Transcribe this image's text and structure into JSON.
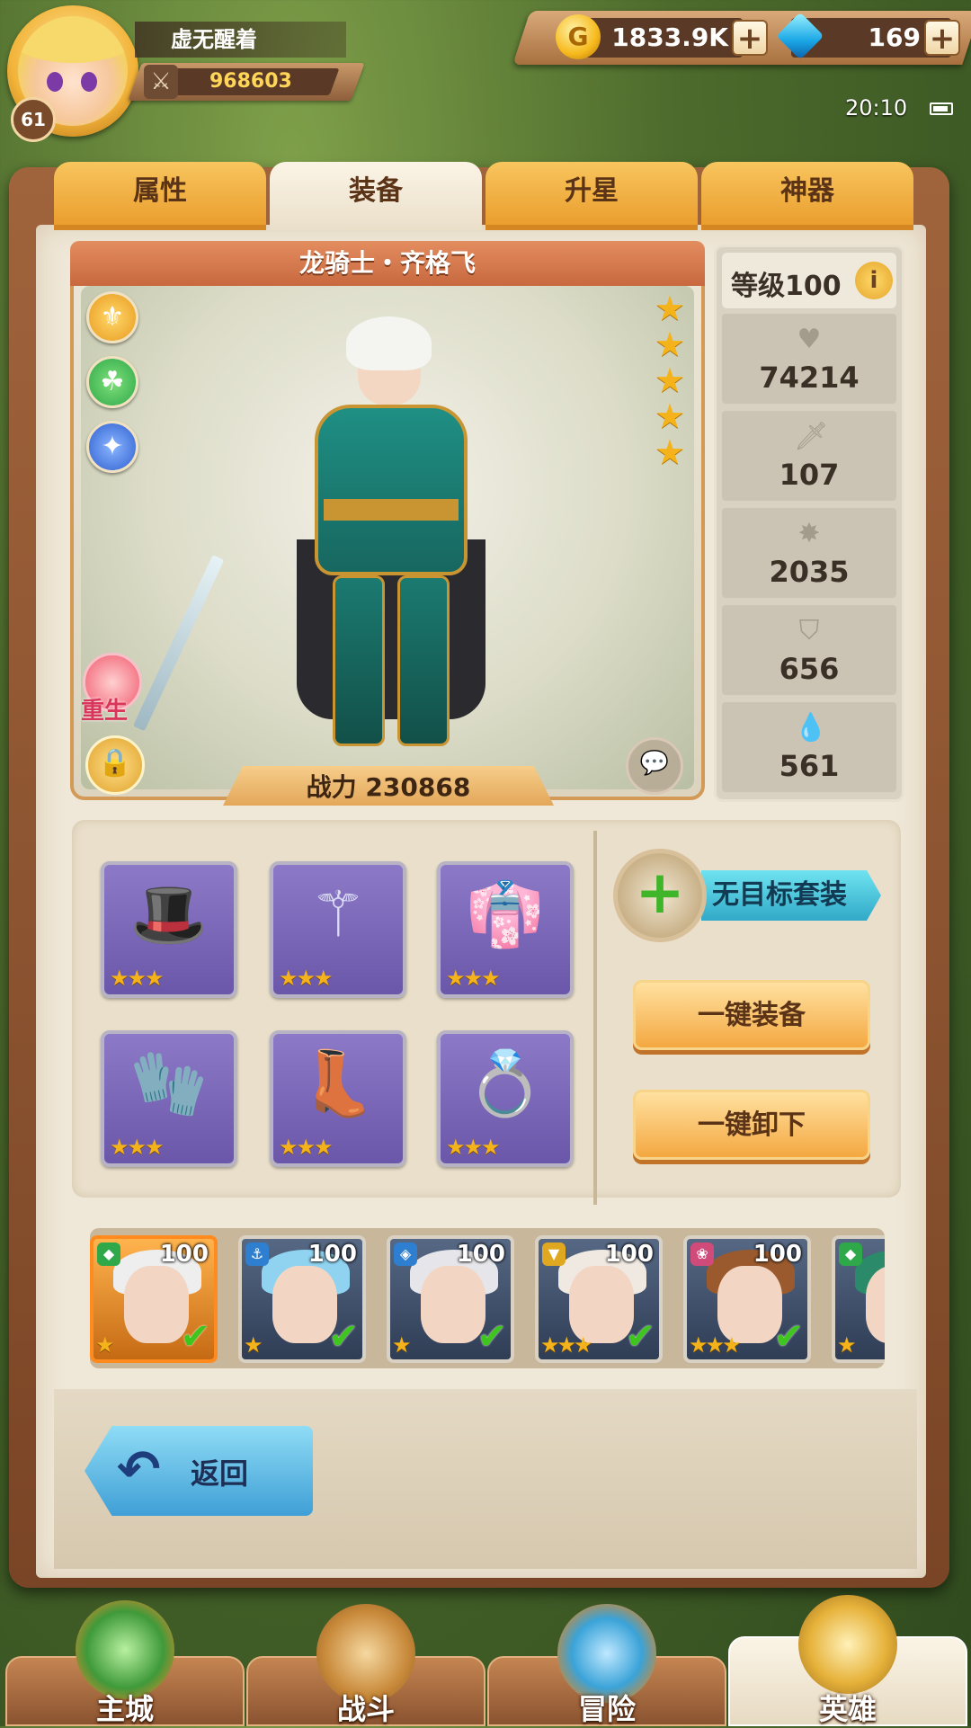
{
  "player": {
    "name": "虚无醒着",
    "level": "61",
    "power": "968603"
  },
  "currency": {
    "gold": "1833.9K",
    "gems": "169",
    "plus": "+"
  },
  "status": {
    "time": "20:10"
  },
  "tabs": [
    {
      "label": "属性"
    },
    {
      "label": "装备"
    },
    {
      "label": "升星"
    },
    {
      "label": "神器"
    }
  ],
  "active_tab": "装备",
  "hero": {
    "title": "龙骑士・齐格飞",
    "stars": 5,
    "rebirth_label": "重生",
    "combat_power": "战力 230868",
    "badges": [
      "sword-class-icon",
      "faction-wolf-icon",
      "skill-icon"
    ]
  },
  "stats": {
    "level": "等级100",
    "info": "i",
    "hp": "74214",
    "attack": "107",
    "speed": "2035",
    "defense": "656",
    "magic": "561"
  },
  "equipment": {
    "slots": [
      {
        "name": "wizard-hat",
        "glyph": "🎩",
        "stars": "★★★"
      },
      {
        "name": "staff",
        "glyph": "⚚",
        "stars": "★★★"
      },
      {
        "name": "robe",
        "glyph": "👘",
        "stars": "★★★"
      },
      {
        "name": "gloves",
        "glyph": "🧤",
        "stars": "★★★"
      },
      {
        "name": "boots",
        "glyph": "👢",
        "stars": "★★★"
      },
      {
        "name": "ring",
        "glyph": "💍",
        "stars": "★★★"
      }
    ],
    "set_label": "无目标套装",
    "set_plus": "+",
    "equip_all": "一键装备",
    "unequip_all": "一键卸下"
  },
  "roster": [
    {
      "level": "100",
      "stars": "★",
      "hair": "#eeeeee",
      "faction": "#2fa84a",
      "selected": true
    },
    {
      "level": "100",
      "stars": "★",
      "hair": "#8fd3f0",
      "faction": "#2f7fd0",
      "selected": false
    },
    {
      "level": "100",
      "stars": "★",
      "hair": "#e6e6ea",
      "faction": "#2f7fd0",
      "selected": false
    },
    {
      "level": "100",
      "stars": "★★★",
      "hair": "#efe9e2",
      "faction": "#e0a820",
      "selected": false
    },
    {
      "level": "100",
      "stars": "★★★",
      "hair": "#9a5a2e",
      "faction": "#d04a7a",
      "selected": false
    },
    {
      "level": "",
      "stars": "★",
      "hair": "#2a8a6a",
      "faction": "#2fa84a",
      "selected": false
    }
  ],
  "back_label": "返回",
  "nav": [
    {
      "label": "主城"
    },
    {
      "label": "战斗"
    },
    {
      "label": "冒险"
    },
    {
      "label": "英雄"
    }
  ]
}
